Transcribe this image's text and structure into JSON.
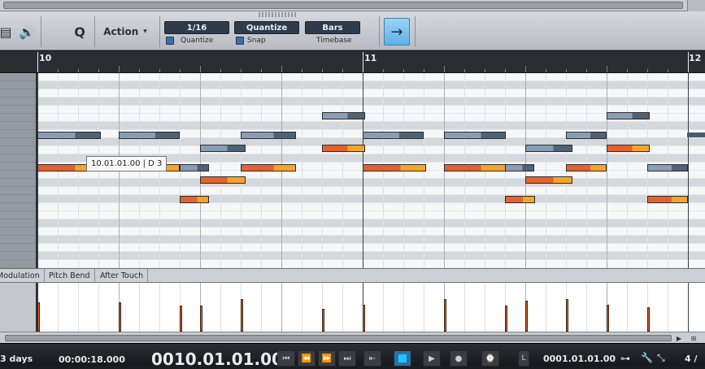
{
  "toolbar": {
    "action_label": "Action",
    "action_chevron": "▾",
    "quantize_value": "1/16",
    "quantize_label": "Quantize",
    "snap_value": "Quantize",
    "snap_label": "Snap",
    "timebase_value": "Bars",
    "timebase_label": "Timebase",
    "follow_icon": "→",
    "q_icon": "Q",
    "speaker_icon": "🔊"
  },
  "ruler": {
    "bars": [
      "10",
      "11",
      "12"
    ]
  },
  "tooltip": {
    "text": "10.01.01.00 | D 3"
  },
  "automation_tabs": [
    "Modulation",
    "Pitch Bend",
    "After Touch"
  ],
  "transport": {
    "duration": "3 days",
    "seconds": "00:00:18.000",
    "position": "0010.01.01.00",
    "loop_start": "0001.01.01.00",
    "signature_partial": "4 /"
  },
  "colors": {
    "note_gray": "#8a9db4",
    "note_orange": "#e5622e",
    "follow_accent": "#5fb0e6"
  }
}
